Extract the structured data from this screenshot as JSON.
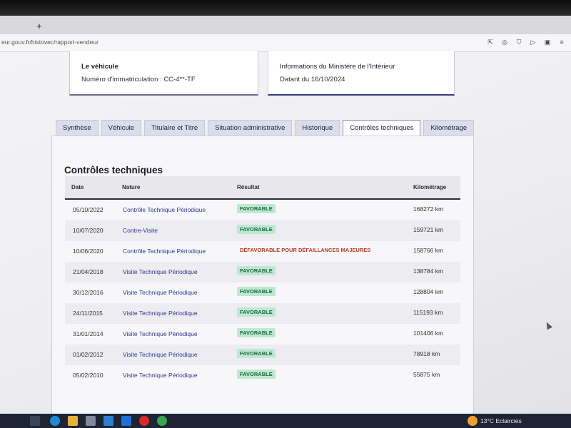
{
  "browser": {
    "url": "eur.gouv.fr/histovec/rapport-vendeur",
    "new_tab_label": "+",
    "toolbar_icons": [
      "share-icon",
      "camera-icon",
      "shield-icon",
      "play-icon",
      "pdf-icon",
      "menu-icon"
    ]
  },
  "vehicle_card": {
    "title": "Le véhicule",
    "text": "Numéro d'immatriculation : CC-4**-TF"
  },
  "ministry_card": {
    "title": "Informations du Ministère de l'Intérieur",
    "text": "Datant du 16/10/2024"
  },
  "tabs": [
    {
      "label": "Synthèse"
    },
    {
      "label": "Véhicule"
    },
    {
      "label": "Titulaire et Titre"
    },
    {
      "label": "Situation administrative"
    },
    {
      "label": "Historique"
    },
    {
      "label": "Contrôles techniques"
    },
    {
      "label": "Kilométrage"
    }
  ],
  "panel": {
    "title": "Contrôles techniques",
    "columns": {
      "date": "Date",
      "nature": "Nature",
      "resultat": "Résultat",
      "kilometrage": "Kilométrage"
    },
    "rows": [
      {
        "date": "05/10/2022",
        "nature": "Contrôle Technique Périodique",
        "resultat": "FAVORABLE",
        "km": "168272 km"
      },
      {
        "date": "10/07/2020",
        "nature": "Contre-Visite",
        "resultat": "FAVORABLE",
        "km": "159721 km"
      },
      {
        "date": "10/06/2020",
        "nature": "Contrôle Technique Périodique",
        "resultat": "DÉFAVORABLE POUR DÉFAILLANCES MAJEURES",
        "km": "158766 km"
      },
      {
        "date": "21/04/2018",
        "nature": "Visite Technique Périodique",
        "resultat": "FAVORABLE",
        "km": "138784 km"
      },
      {
        "date": "30/12/2016",
        "nature": "Visite Technique Périodique",
        "resultat": "FAVORABLE",
        "km": "128804 km"
      },
      {
        "date": "24/11/2015",
        "nature": "Visite Technique Périodique",
        "resultat": "FAVORABLE",
        "km": "115193 km"
      },
      {
        "date": "31/01/2014",
        "nature": "Visite Technique Périodique",
        "resultat": "FAVORABLE",
        "km": "101406 km"
      },
      {
        "date": "01/02/2012",
        "nature": "Visite Technique Périodique",
        "resultat": "FAVORABLE",
        "km": "78918 km"
      },
      {
        "date": "05/02/2010",
        "nature": "Visite Technique Périodique",
        "resultat": "FAVORABLE",
        "km": "55875 km"
      }
    ]
  },
  "taskbar": {
    "weather": "13°C  Eclaircies",
    "apps": [
      "task-view-icon",
      "edge-icon",
      "file-explorer-icon",
      "store-icon",
      "mail-icon",
      "l-app-icon",
      "opera-icon",
      "chrome-icon"
    ]
  },
  "colors": {
    "favorable_bg": "#bfe8d2",
    "favorable_text": "#1a6b3d",
    "defavorable_text": "#b5391f",
    "tab_bg": "#dcdcea"
  }
}
